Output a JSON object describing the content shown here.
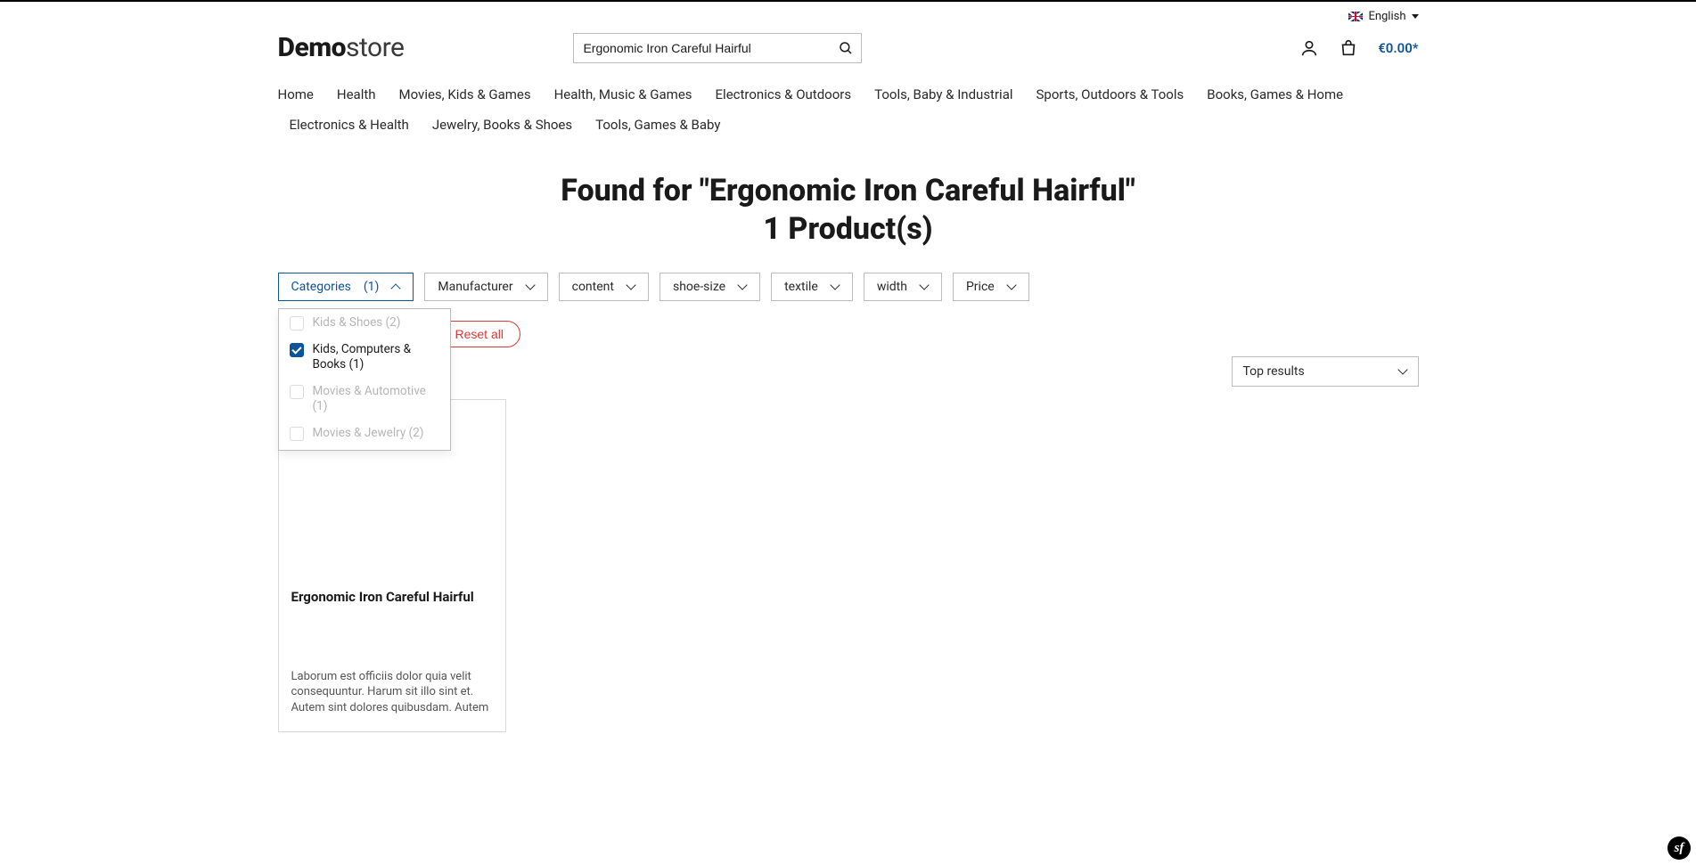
{
  "top_bar": {
    "language": "English"
  },
  "logo": {
    "bold": "Demo",
    "rest": "store"
  },
  "search": {
    "value": "Ergonomic Iron Careful Hairful"
  },
  "cart": {
    "total": "€0.00*"
  },
  "nav": [
    "Home",
    "Health",
    "Movies, Kids & Games",
    "Health, Music & Games",
    "Electronics & Outdoors",
    "Tools, Baby & Industrial",
    "Sports, Outdoors & Tools",
    "Books, Games & Home",
    "Electronics & Health",
    "Jewelry, Books & Shoes",
    "Tools, Games & Baby"
  ],
  "results": {
    "prefix": "Found for",
    "query": "Ergonomic Iron Careful Hairful",
    "count_line": "1 Product(s)"
  },
  "filters": {
    "categories": {
      "label": "Categories",
      "count": "(1)"
    },
    "others": [
      "Manufacturer",
      "content",
      "shoe-size",
      "textile",
      "width",
      "Price"
    ]
  },
  "category_options": [
    {
      "label": "Kids & Shoes (2)",
      "checked": false,
      "disabled": true
    },
    {
      "label": "Kids, Computers & Books (1)",
      "checked": true,
      "disabled": false
    },
    {
      "label": "Movies & Automotive (1)",
      "checked": false,
      "disabled": true
    },
    {
      "label": "Movies & Jewelry (2)",
      "checked": false,
      "disabled": true
    }
  ],
  "reset": {
    "label": "Reset all"
  },
  "sort": {
    "selected": "Top results"
  },
  "product": {
    "name": "Ergonomic Iron Careful Hairful",
    "desc": "Laborum est officiis dolor quia velit consequuntur. Harum sit illo sint et. Autem sint dolores quibusdam. Autem veniam a..."
  }
}
